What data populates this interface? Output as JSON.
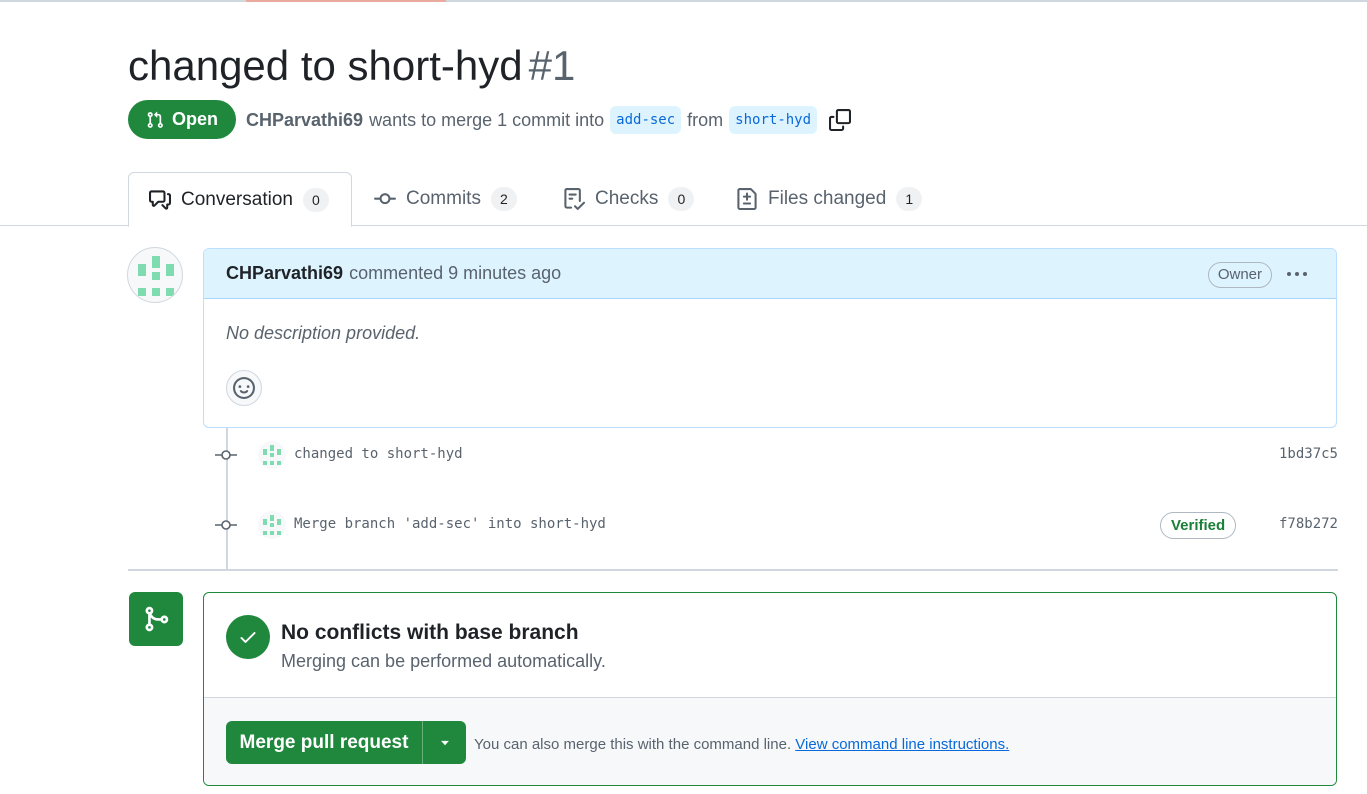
{
  "pr": {
    "title": "changed to short-hyd",
    "number": "#1",
    "state": "Open",
    "author": "CHParvathi69",
    "summary": "wants to merge 1 commit into",
    "base_branch": "add-sec",
    "from_label": "from",
    "head_branch": "short-hyd"
  },
  "tabs": [
    {
      "label": "Conversation",
      "count": "0"
    },
    {
      "label": "Commits",
      "count": "2"
    },
    {
      "label": "Checks",
      "count": "0"
    },
    {
      "label": "Files changed",
      "count": "1"
    }
  ],
  "comment": {
    "author": "CHParvathi69",
    "action": "commented 9 minutes ago",
    "role_badge": "Owner",
    "body": "No description provided."
  },
  "commits": [
    {
      "message": "changed to short-hyd",
      "sha": "1bd37c5",
      "verified": ""
    },
    {
      "message": "Merge branch 'add-sec' into short-hyd",
      "sha": "f78b272",
      "verified": "Verified"
    }
  ],
  "merge": {
    "title": "No conflicts with base branch",
    "subtitle": "Merging can be performed automatically.",
    "button_label": "Merge pull request",
    "note": "You can also merge this with the command line.",
    "link": "View command line instructions."
  },
  "colors": {
    "green": "#1f883d",
    "blue_link": "#0969da",
    "header_blue": "#ddf4ff",
    "avatar_green": "#7fdcb0"
  }
}
